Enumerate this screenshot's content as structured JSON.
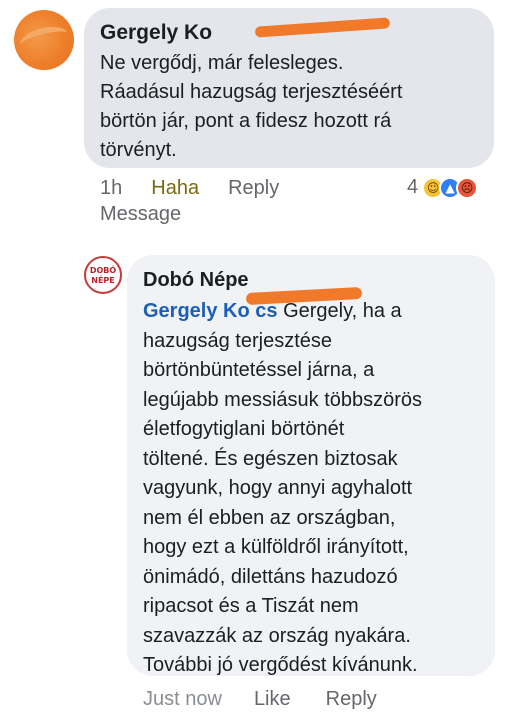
{
  "comment1": {
    "author": "Gergely Ko",
    "lines": [
      "Ne vergődj, már felesleges.",
      "Ráadásul hazugság terjesztéséért",
      "börtön jár, pont a fidesz hozott rá",
      "törvényt."
    ],
    "timestamp": "1h",
    "reaction_label": "Haha",
    "reply_label": "Reply",
    "message_label": "Message",
    "reaction_count": "4",
    "reactions": [
      "haha-reaction-icon",
      "like-reaction-icon",
      "angry-reaction-icon"
    ]
  },
  "reply1": {
    "author": "Dobó Népe",
    "avatar_logo": [
      "DOBÓ",
      "NÉPE"
    ],
    "mention": "Gergely Ko    cs",
    "mention_trailing": " Gergely, ha a",
    "lines": [
      "hazugság terjesztése",
      "börtönbüntetéssel járna, a",
      "legújabb messiásuk többszörös",
      "életfogytiglani börtönét",
      "töltené. És egészen biztosak",
      "vagyunk, hogy annyi agyhalott",
      "nem él ebben az országban,",
      "hogy ezt a külföldről irányított,",
      "önimádó, dilettáns hazudozó",
      "ripacsot és a Tiszát nem",
      "szavazzák az ország nyakára.",
      "További jó vergődést kívánunk."
    ],
    "timestamp": "Just now",
    "like_label": "Like",
    "reply_label": "Reply"
  },
  "colors": {
    "bubble_primary": "#e4e6eb",
    "bubble_reply": "#f0f2f5",
    "mention": "#1b5fb8",
    "redaction": "#f07a2a"
  }
}
